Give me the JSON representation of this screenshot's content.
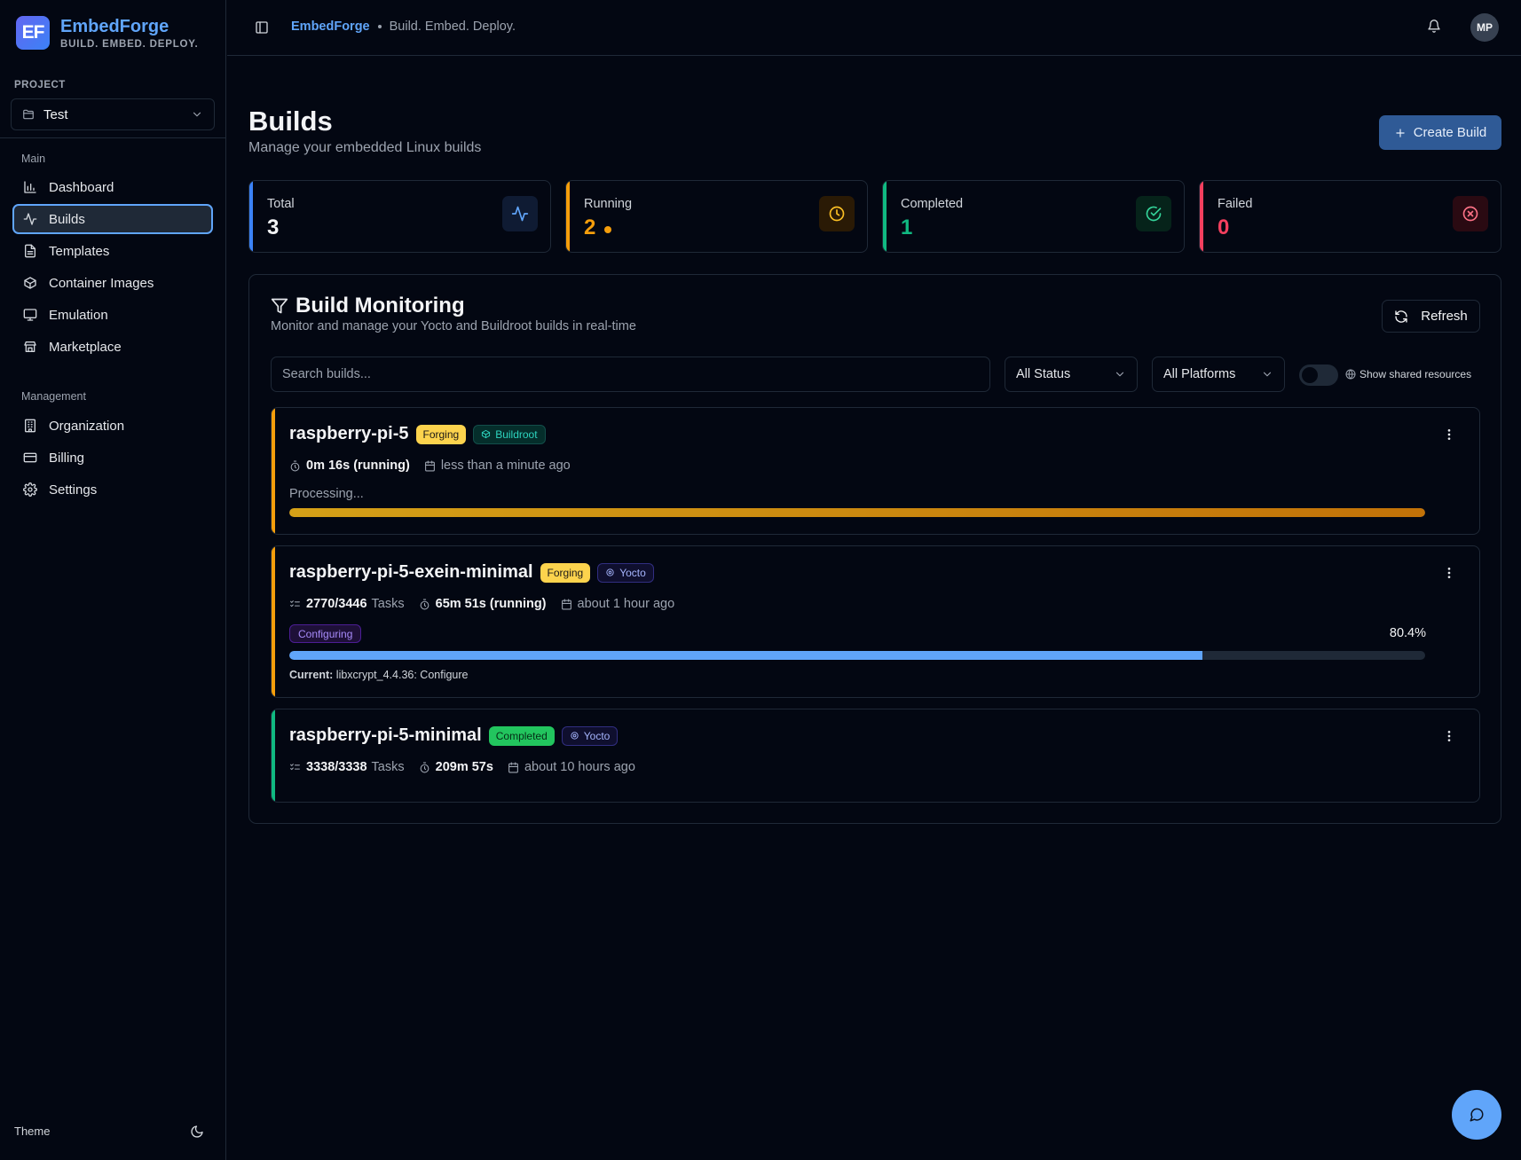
{
  "brand": {
    "logo": "EF",
    "name": "EmbedForge",
    "tagline": "BUILD. EMBED. DEPLOY."
  },
  "project": {
    "label": "PROJECT",
    "selected": "Test"
  },
  "nav": {
    "main_label": "Main",
    "main_items": [
      {
        "label": "Dashboard",
        "icon": "bar-chart-icon"
      },
      {
        "label": "Builds",
        "icon": "activity-icon",
        "active": true
      },
      {
        "label": "Templates",
        "icon": "file-icon"
      },
      {
        "label": "Container Images",
        "icon": "package-icon"
      },
      {
        "label": "Emulation",
        "icon": "monitor-icon"
      },
      {
        "label": "Marketplace",
        "icon": "store-icon"
      }
    ],
    "management_label": "Management",
    "management_items": [
      {
        "label": "Organization",
        "icon": "building-icon"
      },
      {
        "label": "Billing",
        "icon": "credit-card-icon"
      },
      {
        "label": "Settings",
        "icon": "gear-icon"
      }
    ]
  },
  "theme": {
    "label": "Theme",
    "icon": "moon-icon"
  },
  "header": {
    "app": "EmbedForge",
    "tagline": "Build. Embed. Deploy.",
    "avatar": "MP"
  },
  "page": {
    "title": "Builds",
    "subtitle": "Manage your embedded Linux builds",
    "create_label": "Create Build"
  },
  "stats": [
    {
      "label": "Total",
      "value": "3",
      "color": "#3b82f6"
    },
    {
      "label": "Running",
      "value": "2",
      "color": "#f59e0b"
    },
    {
      "label": "Completed",
      "value": "1",
      "color": "#10b981"
    },
    {
      "label": "Failed",
      "value": "0",
      "color": "#f43f5e"
    }
  ],
  "monitor": {
    "title": "Build Monitoring",
    "subtitle": "Monitor and manage your Yocto and Buildroot builds in real-time",
    "refresh_label": "Refresh",
    "search_placeholder": "Search builds...",
    "status_filter": "All Status",
    "platform_filter": "All Platforms",
    "shared_label": "Show shared resources",
    "shared_enabled": false
  },
  "builds": [
    {
      "name": "raspberry-pi-5",
      "status": "Forging",
      "system": "Buildroot",
      "duration": "0m 16s (running)",
      "time": "less than a minute ago",
      "processing": "Processing...",
      "progress": 1.0
    },
    {
      "name": "raspberry-pi-5-exein-minimal",
      "status": "Forging",
      "system": "Yocto",
      "tasks": "2770/3446",
      "tasks_label": "Tasks",
      "duration": "65m 51s (running)",
      "time": "about 1 hour ago",
      "phase": "Configuring",
      "percent": "80.4%",
      "progress": 0.804,
      "current_label": "Current:",
      "current_task": "libxcrypt_4.4.36: Configure"
    },
    {
      "name": "raspberry-pi-5-minimal",
      "status": "Completed",
      "system": "Yocto",
      "tasks": "3338/3338",
      "tasks_label": "Tasks",
      "duration": "209m 57s",
      "time": "about 10 hours ago"
    }
  ]
}
